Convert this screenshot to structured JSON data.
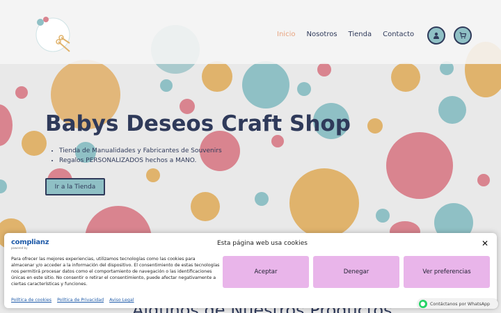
{
  "brand": {
    "logo_text": "Babys Deseos Craft Shop"
  },
  "nav": {
    "items": [
      {
        "label": "Inicio",
        "active": true
      },
      {
        "label": "Nosotros",
        "active": false
      },
      {
        "label": "Tienda",
        "active": false
      },
      {
        "label": "Contacto",
        "active": false
      }
    ],
    "account_icon": "user-icon",
    "cart_icon": "cart-icon"
  },
  "hero": {
    "title": "Babys Deseos Craft Shop",
    "bullets": [
      "Tienda de Manualidades y Fabricantes de Souvenirs",
      "Regalos PERSONALIZADOS hechos a MANO."
    ],
    "cta_label": "Ir a la Tienda"
  },
  "products": {
    "section_title": "Algunos de Nuestros Productos"
  },
  "cookie_banner": {
    "brand": "complianz",
    "brand_sub": "powered by",
    "title": "Esta página web usa cookies",
    "text": "Para ofrecer las mejores experiencias, utilizamos tecnologías como las cookies para almacenar y/o acceder a la información del dispositivo. El consentimiento de estas tecnologías nos permitirá procesar datos como el comportamiento de navegación o las identificaciones únicas en este sitio. No consentir o retirar el consentimiento, puede afectar negativamente a ciertas características y funciones.",
    "accept_label": "Aceptar",
    "deny_label": "Denegar",
    "prefs_label": "Ver preferencias",
    "links": [
      "Política de cookies",
      "Política de Privacidad",
      "Aviso Legal"
    ]
  },
  "whatsapp": {
    "label": "Contáctanos por WhatsApp"
  },
  "colors": {
    "teal": "#8fc0c5",
    "pink": "#d9848f",
    "mustard": "#e0b36c",
    "navy": "#2f3a5a",
    "active_nav": "#e8a27d",
    "cookie_button": "#e9b5ea"
  }
}
